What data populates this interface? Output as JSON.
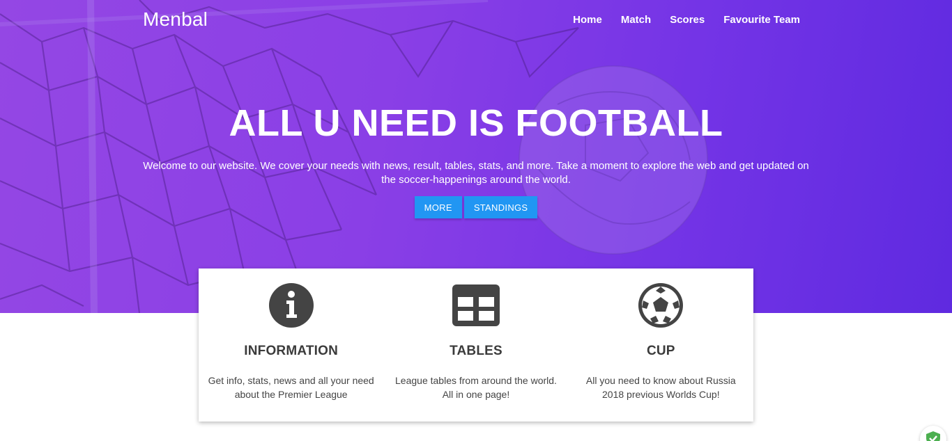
{
  "header": {
    "brand": "Menbal",
    "nav": [
      "Home",
      "Match",
      "Scores",
      "Favourite Team"
    ]
  },
  "hero": {
    "title": "ALL U NEED IS FOOTBALL",
    "text": "Welcome to our website. We cover your needs with news, result, tables, stats, and more. Take a moment to explore the web and get updated on the soccer-happenings around the world.",
    "buttons": [
      "MORE",
      "STANDINGS"
    ]
  },
  "features": [
    {
      "icon": "info-icon",
      "title": "INFORMATION",
      "text": "Get info, stats, news and all your need about the Premier League"
    },
    {
      "icon": "table-icon",
      "title": "TABLES",
      "text": "League tables from around the world. All in one page!"
    },
    {
      "icon": "soccer-ball-icon",
      "title": "CUP",
      "text": "All you need to know about Russia 2018 previous Worlds Cup!"
    }
  ],
  "colors": {
    "hero_purple": "#8a3fe6",
    "button_blue": "#2196f3",
    "icon_dark": "#444444",
    "badge_green": "#4caf50"
  }
}
